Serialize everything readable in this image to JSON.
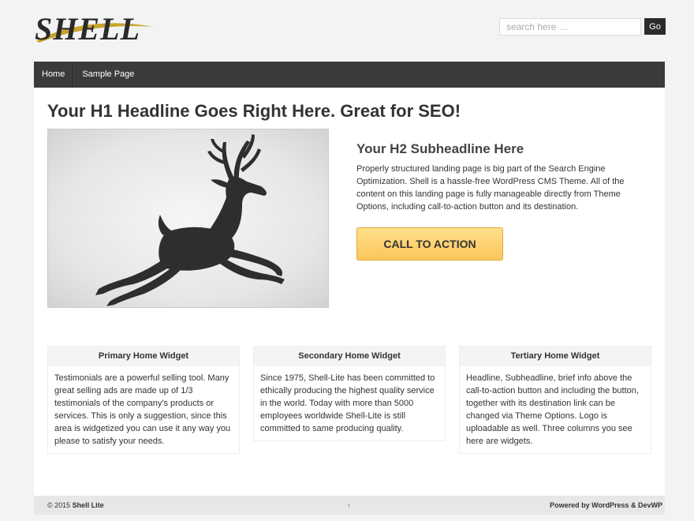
{
  "header": {
    "logo_text": "SHELL",
    "search": {
      "placeholder": "search here …",
      "button_label": "Go"
    }
  },
  "nav": {
    "items": [
      {
        "label": "Home"
      },
      {
        "label": "Sample Page"
      }
    ]
  },
  "main": {
    "h1": "Your H1 Headline Goes Right Here. Great for SEO!",
    "h2": "Your H2 Subheadline Here",
    "intro": "Properly structured landing page is big part of the Search Engine Optimization. Shell is a hassle-free WordPress CMS Theme. All of the content on this landing page is fully manageable directly from Theme Options, including call-to-action button and its destination.",
    "cta_label": "CALL TO ACTION",
    "hero_image_icon": "deer-silhouette-icon"
  },
  "widgets": [
    {
      "title": "Primary Home Widget",
      "body": "Testimonials are a powerful selling tool. Many great selling ads are made up of 1/3 testimonials of the company's products or services. This is only a suggestion, since this area is widgetized you can use it any way you please to satisfy your needs."
    },
    {
      "title": "Secondary Home Widget",
      "body": "Since 1975, Shell-Lite has been committed to ethically producing the highest quality service in the world. Today with more than 5000 employees worldwide Shell-Lite is still committed to same producing quality."
    },
    {
      "title": "Tertiary Home Widget",
      "body": "Headline, Subheadline, brief info above the call-to-action button and including the button, together with its destination link can be changed via Theme Options. Logo is uploadable as well. Three columns you see here are widgets."
    }
  ],
  "footer": {
    "copyright_prefix": "© 2015 ",
    "site_name": "Shell Lite",
    "back_to_top": "↑",
    "powered_by": "Powered by WordPress & DevWP"
  },
  "colors": {
    "nav_bg": "#3b3b3b",
    "cta_top": "#ffe08a",
    "cta_bottom": "#fbc65c",
    "logo_swoosh": "#c9a32c"
  }
}
